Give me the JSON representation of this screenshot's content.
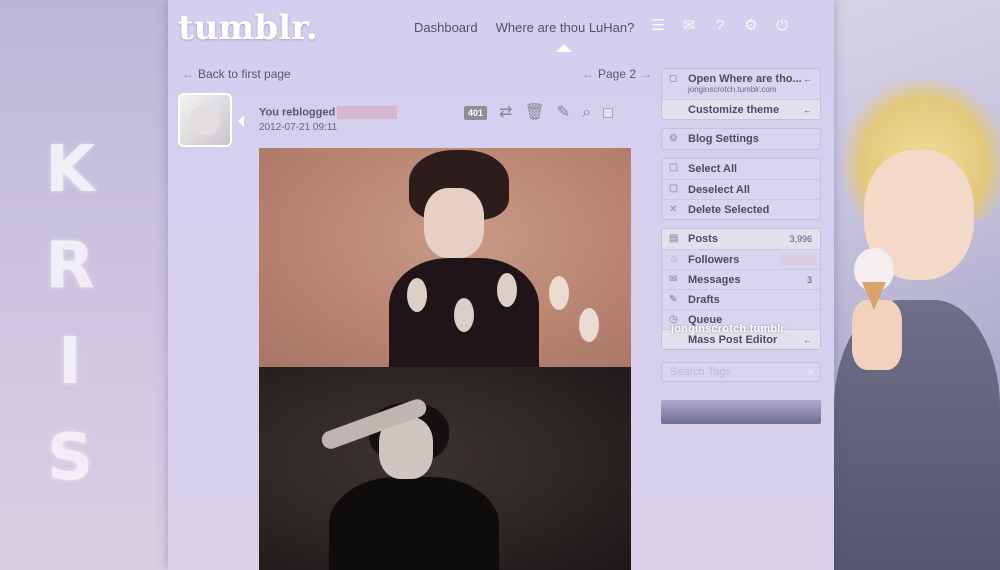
{
  "left_panel": {
    "letters": [
      "K",
      "R",
      "I",
      "S"
    ]
  },
  "header": {
    "logo": "tumblr.",
    "nav": [
      "Dashboard",
      "Where are thou LuHan?"
    ],
    "icons": [
      "list-icon",
      "mail-icon",
      "help-icon",
      "gear-icon",
      "power-icon"
    ]
  },
  "pager": {
    "back_label": "Back to first page",
    "next_label": "Page 2"
  },
  "post": {
    "action": "You reblogged",
    "date": "2012-07-21 09:11",
    "notes": "401"
  },
  "sidebar": {
    "blog_group": [
      {
        "label": "Open Where are tho...",
        "sub": "jonginscrotch.tumblr.com",
        "arrow": "←"
      },
      {
        "label": "Customize theme",
        "arrow": "←"
      }
    ],
    "settings": "Blog Settings",
    "select_group": [
      "Select All",
      "Deselect All",
      "Delete Selected"
    ],
    "stats_group": [
      {
        "label": "Posts",
        "count": "3,996"
      },
      {
        "label": "Followers",
        "count": ""
      },
      {
        "label": "Messages",
        "count": "3"
      },
      {
        "label": "Drafts",
        "count": ""
      },
      {
        "label": "Queue",
        "count": ""
      },
      {
        "label": "Mass Post Editor",
        "arrow": "←"
      }
    ],
    "watermark": "jonginscrotch.tumblr",
    "search_placeholder": "Search Tags"
  }
}
